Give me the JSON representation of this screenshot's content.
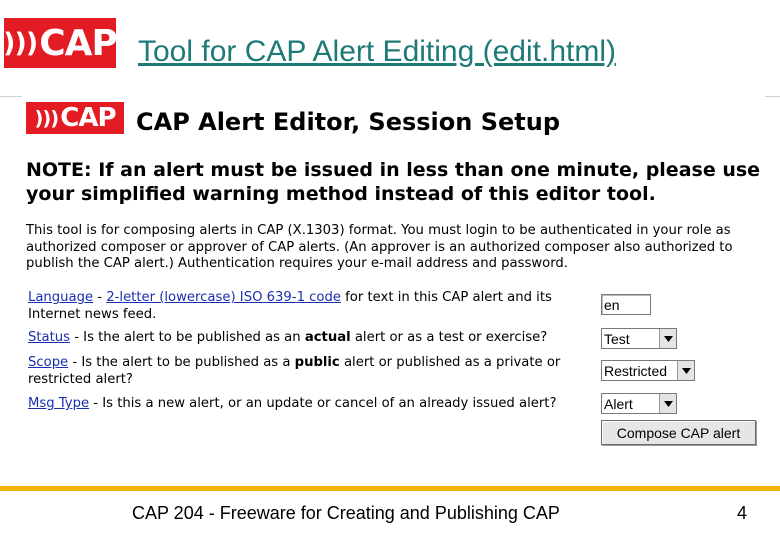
{
  "slide": {
    "logo_text": "CAP",
    "title": "Tool for CAP Alert Editing (edit.html)",
    "footer_text": "CAP 204 - Freeware for Creating and Publishing CAP",
    "page_number": "4"
  },
  "editor": {
    "logo_text": "CAP",
    "heading": "CAP Alert Editor, Session Setup",
    "note": "NOTE: If an alert must be issued in less than one minute, please use your simplified warning method instead of this editor tool.",
    "intro": "This tool is for composing alerts in CAP (X.1303) format. You must login to be authenticated in your role as authorized composer or approver of CAP alerts. (An approver is an authorized composer also authorized to publish the CAP alert.) Authentication requires your e-mail address and password.",
    "fields": {
      "language": {
        "label": "Language",
        "sep": " - ",
        "link": "2-letter (lowercase) ISO 639-1 code",
        "rest": " for text in this CAP alert and its Internet news feed.",
        "value": "en"
      },
      "status": {
        "label": "Status",
        "pre": " - Is the alert to be published as an ",
        "bold": "actual",
        "post": " alert or as a test or exercise?",
        "value": "Test"
      },
      "scope": {
        "label": "Scope",
        "pre": " - Is the alert to be published as a ",
        "bold": "public",
        "post": " alert or published as a private or restricted alert?",
        "value": "Restricted"
      },
      "msgtype": {
        "label": "Msg Type",
        "rest": " - Is this a new alert, or an update or cancel of an already issued alert?",
        "value": "Alert"
      }
    },
    "compose_button": "Compose CAP alert"
  },
  "colors": {
    "brand_red": "#e31b23",
    "title_teal": "#1e7a76",
    "link_blue": "#1a2fb0",
    "footer_gold": "#f2b70f"
  }
}
